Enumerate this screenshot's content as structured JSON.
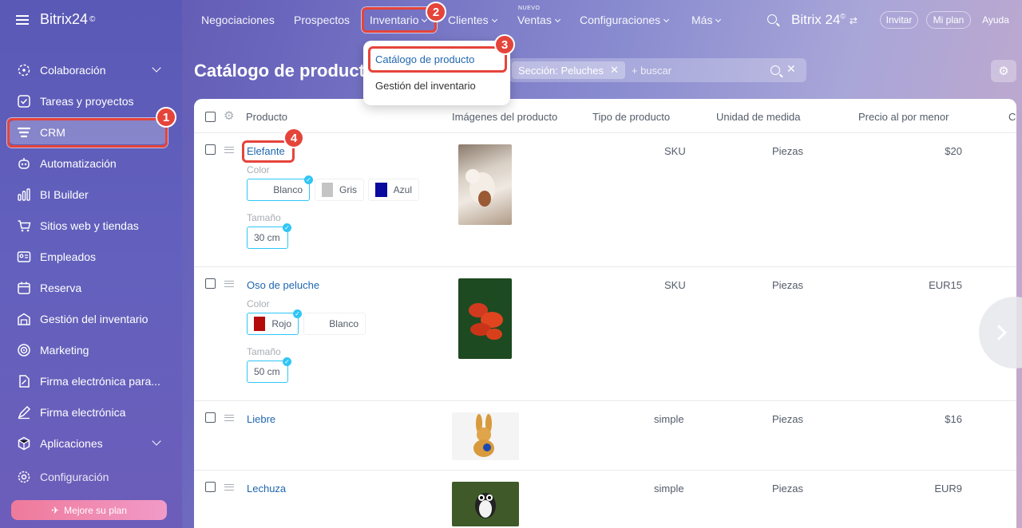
{
  "brand": {
    "name": "Bitrix24",
    "mark": "©"
  },
  "sidebar": {
    "items": [
      {
        "label": "Colaboración",
        "icon": "collab-icon"
      },
      {
        "label": "Tareas y proyectos",
        "icon": "tasks-icon"
      },
      {
        "label": "CRM",
        "icon": "crm-icon"
      },
      {
        "label": "Automatización",
        "icon": "automation-icon"
      },
      {
        "label": "BI Builder",
        "icon": "bi-icon"
      },
      {
        "label": "Sitios web y tiendas",
        "icon": "cart-icon"
      },
      {
        "label": "Empleados",
        "icon": "employees-icon"
      },
      {
        "label": "Reserva",
        "icon": "calendar-icon"
      },
      {
        "label": "Gestión del inventario",
        "icon": "inventory-icon"
      },
      {
        "label": "Marketing",
        "icon": "marketing-icon"
      },
      {
        "label": "Firma electrónica para...",
        "icon": "esign-icon"
      },
      {
        "label": "Firma electrónica",
        "icon": "pen-icon"
      },
      {
        "label": "Aplicaciones",
        "icon": "apps-icon"
      },
      {
        "label": "Configuración",
        "icon": "gear-icon"
      }
    ],
    "upgrade_label": "Mejore su plan"
  },
  "topnav": {
    "items": [
      "Negociaciones",
      "Prospectos",
      "Inventario",
      "Clientes",
      "Ventas",
      "Configuraciones",
      "Más"
    ],
    "nuevo_label": "NUEVO",
    "brand_right": "Bitrix 24",
    "invite_label": "Invitar",
    "myplan_label": "Mi plan",
    "help_label": "Ayuda"
  },
  "dropdown": {
    "items": [
      "Catálogo de producto",
      "Gestión del inventario"
    ]
  },
  "page": {
    "title": "Catálogo de producto",
    "filter_tag": "Sección: Peluches",
    "search_placeholder": "+ buscar"
  },
  "table": {
    "columns": [
      "Producto",
      "Imágenes del producto",
      "Tipo de producto",
      "Unidad de medida",
      "Precio al por menor",
      "C"
    ],
    "rows": [
      {
        "name": "Elefante",
        "color_label": "Color",
        "colors": [
          "Blanco",
          "Gris",
          "Azul"
        ],
        "size_label": "Tamaño",
        "size": "30 cm",
        "type": "SKU",
        "unit": "Piezas",
        "price": "$20"
      },
      {
        "name": "Oso de peluche",
        "color_label": "Color",
        "colors": [
          "Rojo",
          "Blanco"
        ],
        "size_label": "Tamaño",
        "size": "50 cm",
        "type": "SKU",
        "unit": "Piezas",
        "price": "EUR15"
      },
      {
        "name": "Liebre",
        "type": "simple",
        "unit": "Piezas",
        "price": "$16"
      },
      {
        "name": "Lechuza",
        "type": "simple",
        "unit": "Piezas",
        "price": "EUR9"
      }
    ]
  },
  "callouts": [
    "1",
    "2",
    "3",
    "4"
  ],
  "colors": {
    "highlight": "#e5443b",
    "link": "#2067b0",
    "selected": "#2fc6f6"
  }
}
